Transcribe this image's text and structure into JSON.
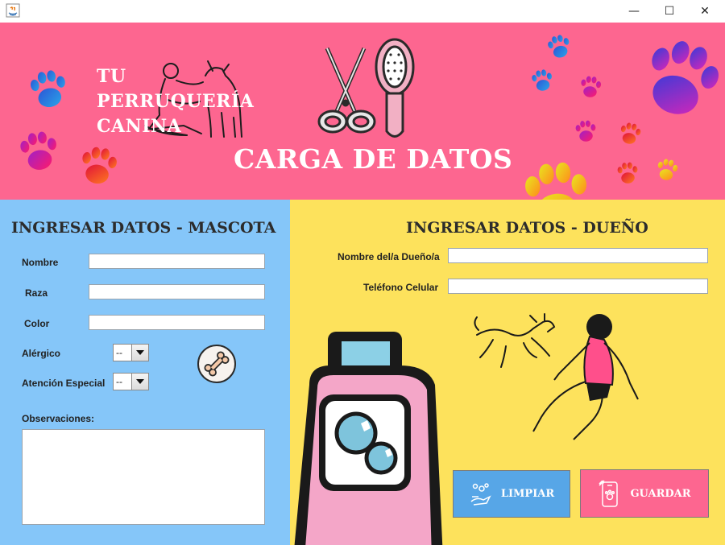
{
  "window": {
    "controls": {
      "minimize": "—",
      "maximize": "☐",
      "close": "✕"
    }
  },
  "header": {
    "brand_lines": [
      "TU",
      "PERRUQUERÍA",
      "CANINA"
    ],
    "title": "CARGA DE DATOS",
    "background_color": "#fd6690"
  },
  "pet_section": {
    "heading": "INGRESAR DATOS - MASCOTA",
    "background_color": "#85c6f9",
    "fields": {
      "nombre": {
        "label": "Nombre",
        "value": ""
      },
      "raza": {
        "label": "Raza",
        "value": ""
      },
      "color": {
        "label": "Color",
        "value": ""
      }
    },
    "allergic": {
      "label": "Alérgico",
      "selected": "--"
    },
    "special_care": {
      "label": "Atención Especial",
      "selected": "--"
    },
    "observations": {
      "label": "Observaciones:",
      "value": ""
    },
    "bone_icon": "bone-icon"
  },
  "owner_section": {
    "heading": "INGRESAR DATOS - DUEÑO",
    "background_color": "#fde25c",
    "fields": {
      "owner_name": {
        "label": "Nombre del/a Dueño/a",
        "value": ""
      },
      "phone": {
        "label": "Teléfono Celular",
        "value": ""
      }
    }
  },
  "buttons": {
    "clear": {
      "label": "LIMPIAR",
      "icon": "cleaning-hand-icon",
      "color": "#57a6e7"
    },
    "save": {
      "label": "GUARDAR",
      "icon": "phone-paw-icon",
      "color": "#fd6690"
    }
  }
}
